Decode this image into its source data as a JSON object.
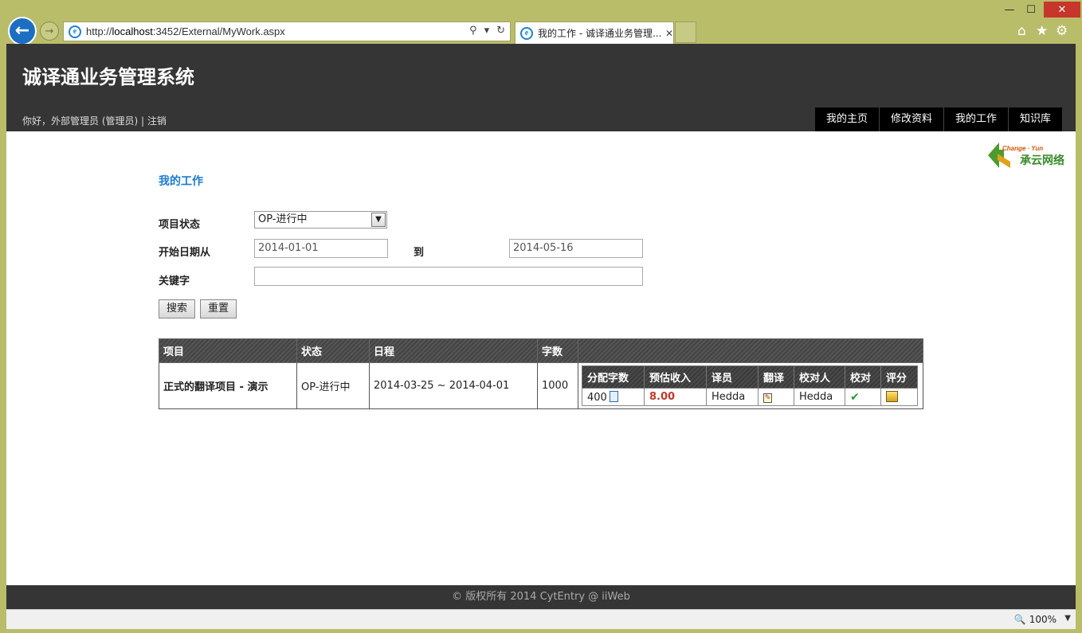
{
  "browser": {
    "url_prefix": "http://",
    "url_host": "localhost",
    "url_rest": ":3452/External/MyWork.aspx",
    "tab_title": "我的工作 - 诚译通业务管理...",
    "zoom": "100%"
  },
  "site": {
    "title": "诚译通业务管理系统",
    "login_text": "你好，外部管理员 (管理员) | 注销",
    "nav": [
      "我的主页",
      "修改资料",
      "我的工作",
      "知识库"
    ],
    "logo_small": "Change · Yun",
    "logo_big": "承云网络"
  },
  "page": {
    "heading": "我的工作",
    "status_label": "项目状态",
    "status_value": "OP-进行中",
    "date_from_label": "开始日期从",
    "date_from": "2014-01-01",
    "date_to_label": "到",
    "date_to": "2014-05-16",
    "keyword_label": "关键字",
    "keyword_value": "",
    "search_button": "搜索",
    "reset_button": "重置"
  },
  "table": {
    "headers": [
      "项目",
      "状态",
      "日程",
      "字数"
    ],
    "rows": [
      {
        "project": "正式的翻译项目 - 演示",
        "status": "OP-进行中",
        "schedule": "2014-03-25 ~ 2014-04-01",
        "words": "1000",
        "sub_headers": [
          "分配字数",
          "预估收入",
          "译员",
          "翻译",
          "校对人",
          "校对",
          "评分"
        ],
        "assigned_words": "400",
        "income": "8.00",
        "translator": "Hedda",
        "proofreader": "Hedda"
      }
    ]
  },
  "footer": {
    "text": "© 版权所有 2014 CytEntry @ iiWeb"
  }
}
